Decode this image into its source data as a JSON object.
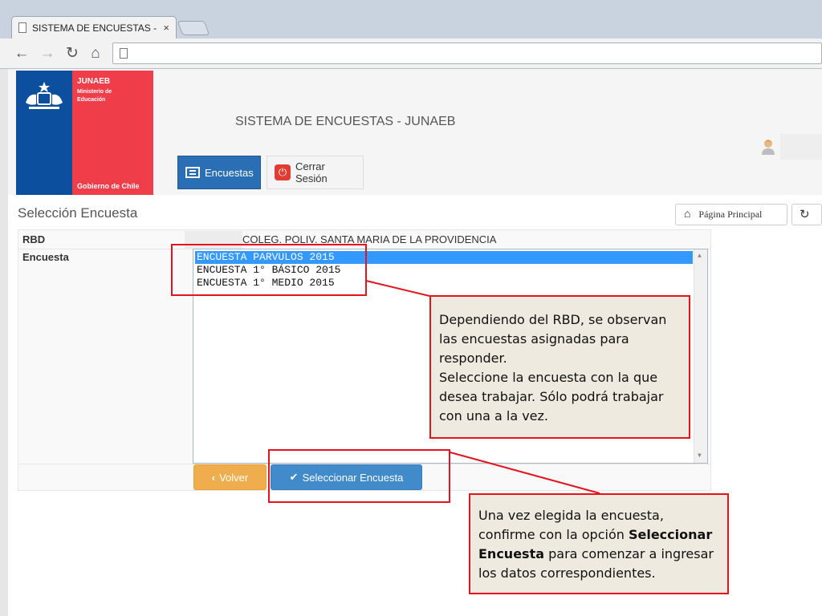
{
  "browser": {
    "tab_title": "SISTEMA DE ENCUESTAS -",
    "tab_close": "×",
    "back": "←",
    "forward": "→",
    "reload": "↻",
    "home": "⌂",
    "url": ""
  },
  "logo": {
    "org": "JUNAEB",
    "ministry": "Ministerio de Educación",
    "government": "Gobierno de Chile"
  },
  "header": {
    "title": "SISTEMA DE ENCUESTAS - JUNAEB"
  },
  "menu": {
    "encuestas": "Encuestas",
    "cerrar_sesion": "Cerrar Sesión"
  },
  "page": {
    "title": "Selección Encuesta",
    "home_button": "Página Principal"
  },
  "form": {
    "rbd_label": "RBD",
    "rbd_name": "COLEG. POLIV. SANTA MARIA DE LA PROVIDENCIA",
    "encuesta_label": "Encuesta",
    "options": [
      "ENCUESTA PARVULOS 2015",
      "ENCUESTA 1° BÁSICO 2015",
      "ENCUESTA 1° MEDIO 2015"
    ],
    "selected_index": 0,
    "back_button": "Volver",
    "select_button": "Seleccionar Encuesta"
  },
  "annotations": {
    "callout1": "Dependiendo del RBD, se observan las encuestas asignadas para responder.\nSeleccione  la encuesta  con la que desea trabajar. Sólo podrá trabajar con una a la vez.",
    "callout2_pre": "Una vez elegida la encuesta, confirme con la opción ",
    "callout2_bold": "Seleccionar Encuesta",
    "callout2_post": " para comenzar a ingresar los datos correspondientes.",
    "accent": "#e5141c"
  },
  "colors": {
    "primary": "#428bca",
    "warning": "#f0ad4e",
    "logo_blue": "#0b4f9e",
    "logo_red": "#ef3e4a",
    "selection": "#3399ff"
  }
}
